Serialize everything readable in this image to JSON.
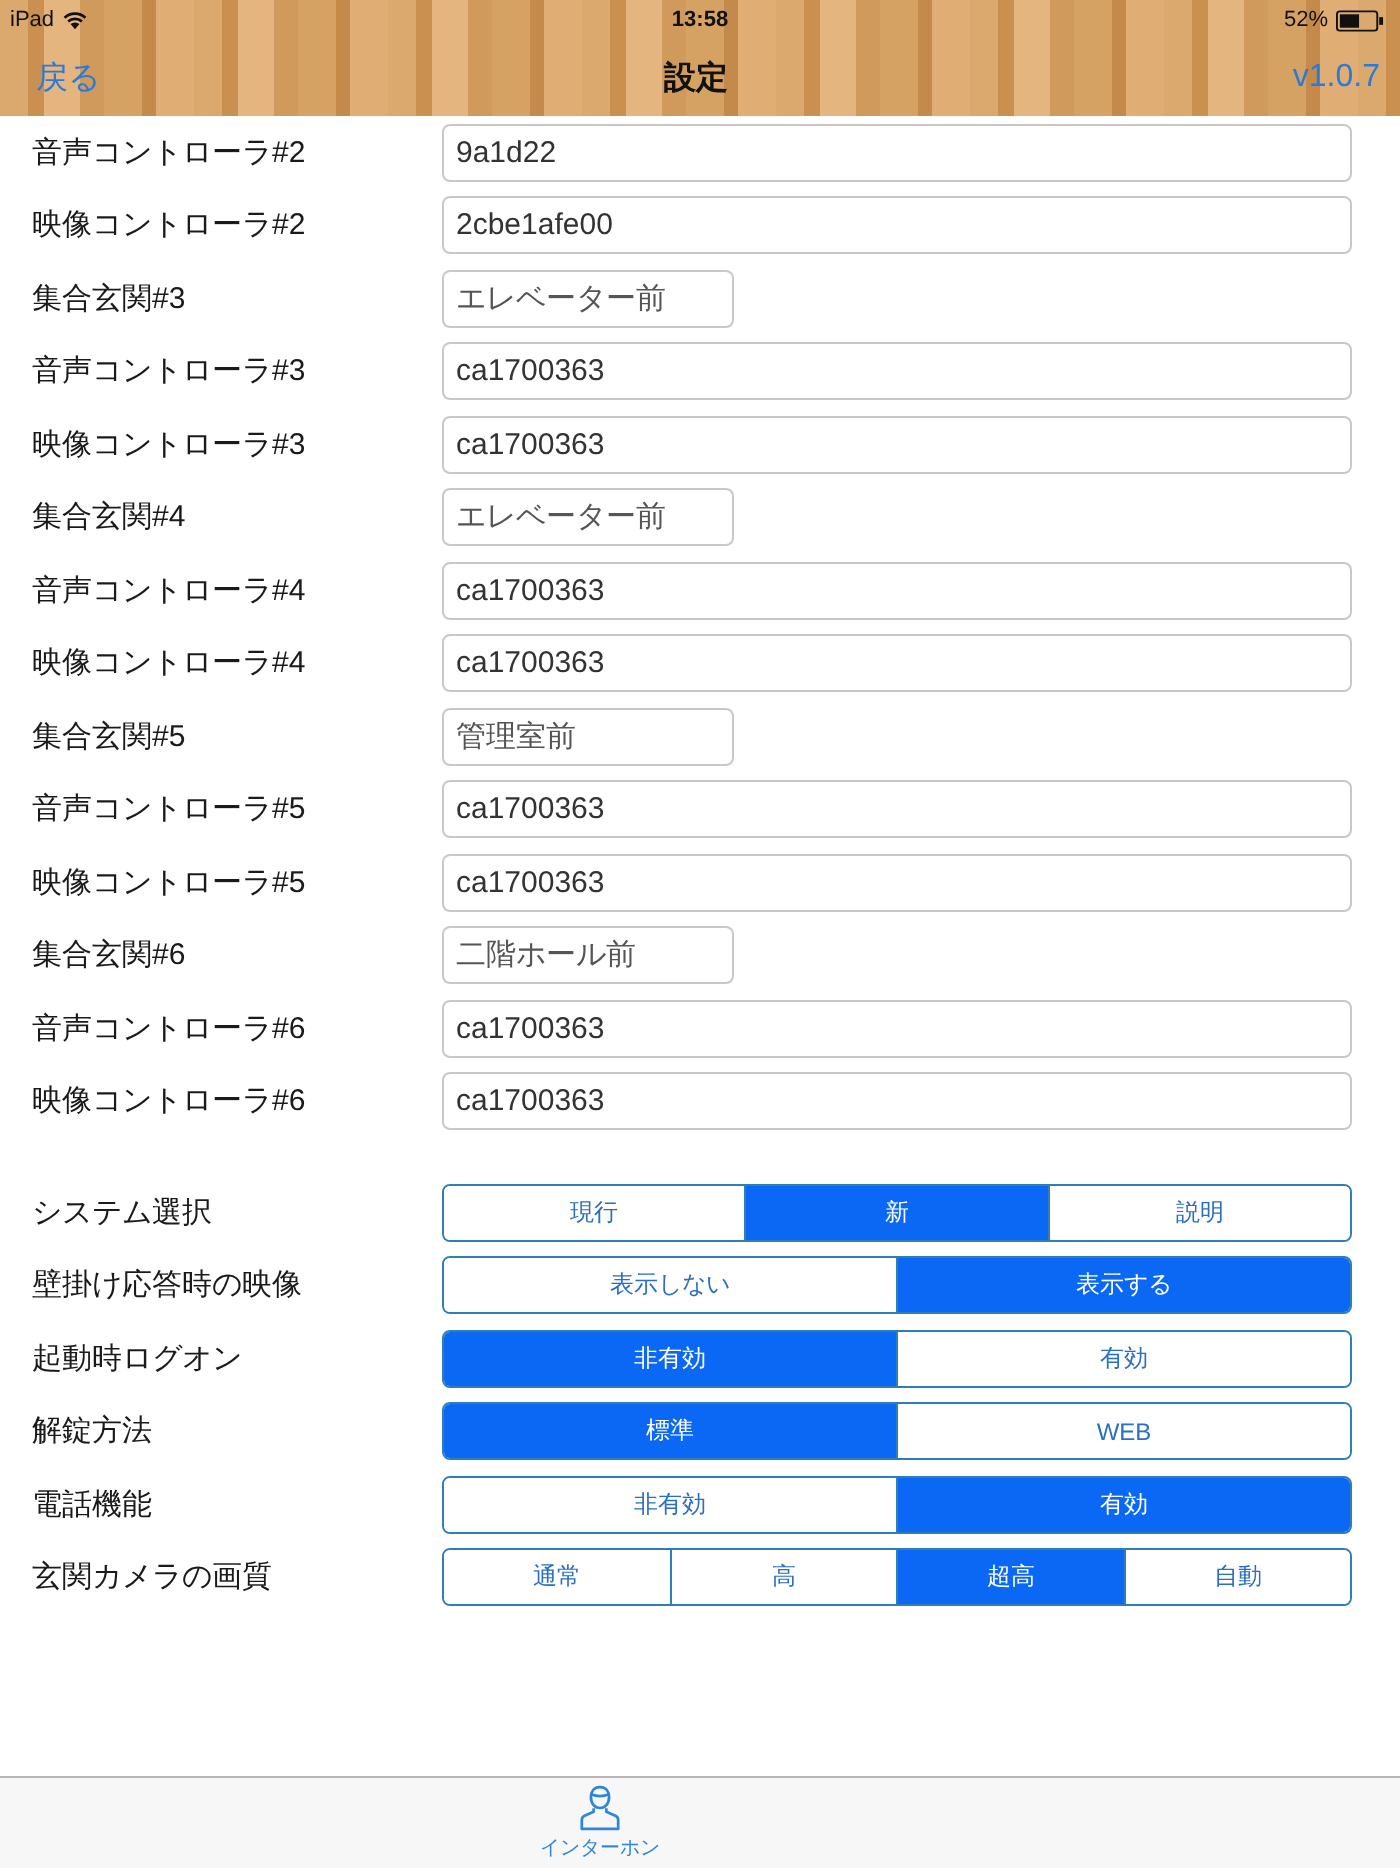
{
  "status_bar": {
    "device": "iPad",
    "time": "13:58",
    "battery": "52%"
  },
  "nav_bar": {
    "back": "戻る",
    "title": "設定",
    "version": "v1.0.7"
  },
  "fields": [
    {
      "label": "音声コントローラ#2",
      "value": "9a1d22",
      "kind": "long"
    },
    {
      "label": "映像コントローラ#2",
      "value": "2cbe1afe00",
      "kind": "long"
    },
    {
      "label": "集合玄関#3",
      "value": "エレベーター前",
      "kind": "short"
    },
    {
      "label": "音声コントローラ#3",
      "value": "ca1700363",
      "kind": "long"
    },
    {
      "label": "映像コントローラ#3",
      "value": "ca1700363",
      "kind": "long"
    },
    {
      "label": "集合玄関#4",
      "value": "エレベーター前",
      "kind": "short"
    },
    {
      "label": "音声コントローラ#4",
      "value": "ca1700363",
      "kind": "long"
    },
    {
      "label": "映像コントローラ#4",
      "value": "ca1700363",
      "kind": "long"
    },
    {
      "label": "集合玄関#5",
      "value": "管理室前",
      "kind": "short"
    },
    {
      "label": "音声コントローラ#5",
      "value": "ca1700363",
      "kind": "long"
    },
    {
      "label": "映像コントローラ#5",
      "value": "ca1700363",
      "kind": "long"
    },
    {
      "label": "集合玄関#6",
      "value": "二階ホール前",
      "kind": "short"
    },
    {
      "label": "音声コントローラ#6",
      "value": "ca1700363",
      "kind": "long"
    },
    {
      "label": "映像コントローラ#6",
      "value": "ca1700363",
      "kind": "long"
    }
  ],
  "settings": [
    {
      "label": "システム選択",
      "options": [
        {
          "label": "現行",
          "selected": false
        },
        {
          "label": "新",
          "selected": true
        },
        {
          "label": "説明",
          "selected": false
        }
      ]
    },
    {
      "label": "壁掛け応答時の映像",
      "options": [
        {
          "label": "表示しない",
          "selected": false
        },
        {
          "label": "表示する",
          "selected": true
        }
      ]
    },
    {
      "label": "起動時ログオン",
      "options": [
        {
          "label": "非有効",
          "selected": true
        },
        {
          "label": "有効",
          "selected": false
        }
      ]
    },
    {
      "label": "解錠方法",
      "options": [
        {
          "label": "標準",
          "selected": true
        },
        {
          "label": "WEB",
          "selected": false
        }
      ]
    },
    {
      "label": "電話機能",
      "options": [
        {
          "label": "非有効",
          "selected": false
        },
        {
          "label": "有効",
          "selected": true
        }
      ]
    },
    {
      "label": "玄関カメラの画質",
      "options": [
        {
          "label": "通常",
          "selected": false
        },
        {
          "label": "高",
          "selected": false
        },
        {
          "label": "超高",
          "selected": true
        },
        {
          "label": "自動",
          "selected": false
        }
      ]
    }
  ],
  "tab_bar": {
    "items": [
      {
        "label": "インターホン",
        "selected": true
      }
    ]
  }
}
